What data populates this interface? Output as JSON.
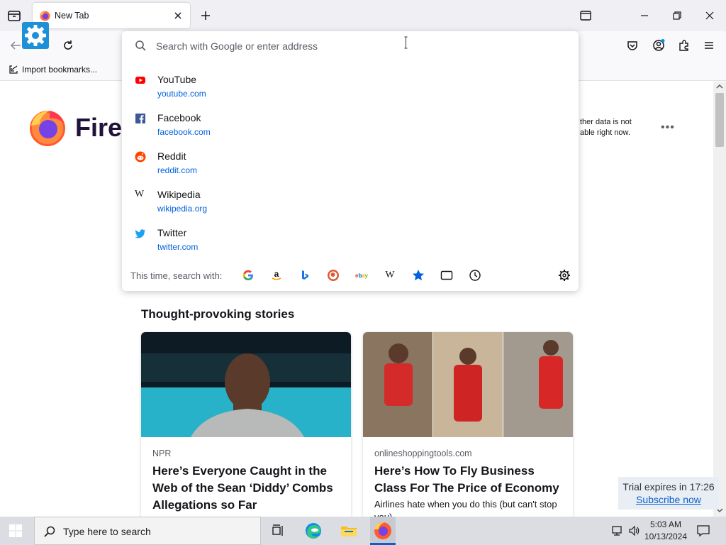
{
  "browser": {
    "tab_title": "New Tab",
    "bookmark_item": "Import bookmarks...",
    "brand_text": "Firef",
    "notice_line1": "ther data is not",
    "notice_line2": "able right now.",
    "more": "•••"
  },
  "urlbar": {
    "placeholder": "Search with Google or enter address",
    "suggestions": [
      {
        "name": "YouTube",
        "url": "youtube.com",
        "icon": "youtube-icon"
      },
      {
        "name": "Facebook",
        "url": "facebook.com",
        "icon": "facebook-icon"
      },
      {
        "name": "Reddit",
        "url": "reddit.com",
        "icon": "reddit-icon"
      },
      {
        "name": "Wikipedia",
        "url": "wikipedia.org",
        "icon": "wikipedia-icon"
      },
      {
        "name": "Twitter",
        "url": "twitter.com",
        "icon": "twitter-icon"
      }
    ],
    "search_with_label": "This time, search with:",
    "engines": [
      "google-icon",
      "amazon-icon",
      "bing-icon",
      "duckduckgo-icon",
      "ebay-icon",
      "wikipedia-icon",
      "bookmarks-star-icon",
      "tabs-icon",
      "history-icon"
    ],
    "wikipedia_glyph": "W"
  },
  "stories": {
    "heading": "Thought-provoking stories",
    "cards": [
      {
        "source": "NPR",
        "headline": "Here’s Everyone Caught in the Web of the Sean ‘Diddy’ Combs Allegations so Far",
        "excerpt": ""
      },
      {
        "source": "onlineshoppingtools.com",
        "headline": "Here’s How To Fly Business Class For The Price of Economy",
        "excerpt": "Airlines hate when you do this (but can't stop you)"
      }
    ]
  },
  "trial": {
    "text": "Trial expires in 17:26",
    "link": "Subscribe now"
  },
  "taskbar": {
    "search_placeholder": "Type here to search",
    "time": "5:03 AM",
    "date": "10/13/2024"
  },
  "colors": {
    "accent": "#0060df",
    "youtube": "#ff0000",
    "facebook": "#1877f2",
    "reddit": "#ff4500",
    "twitter": "#1da1f2"
  }
}
